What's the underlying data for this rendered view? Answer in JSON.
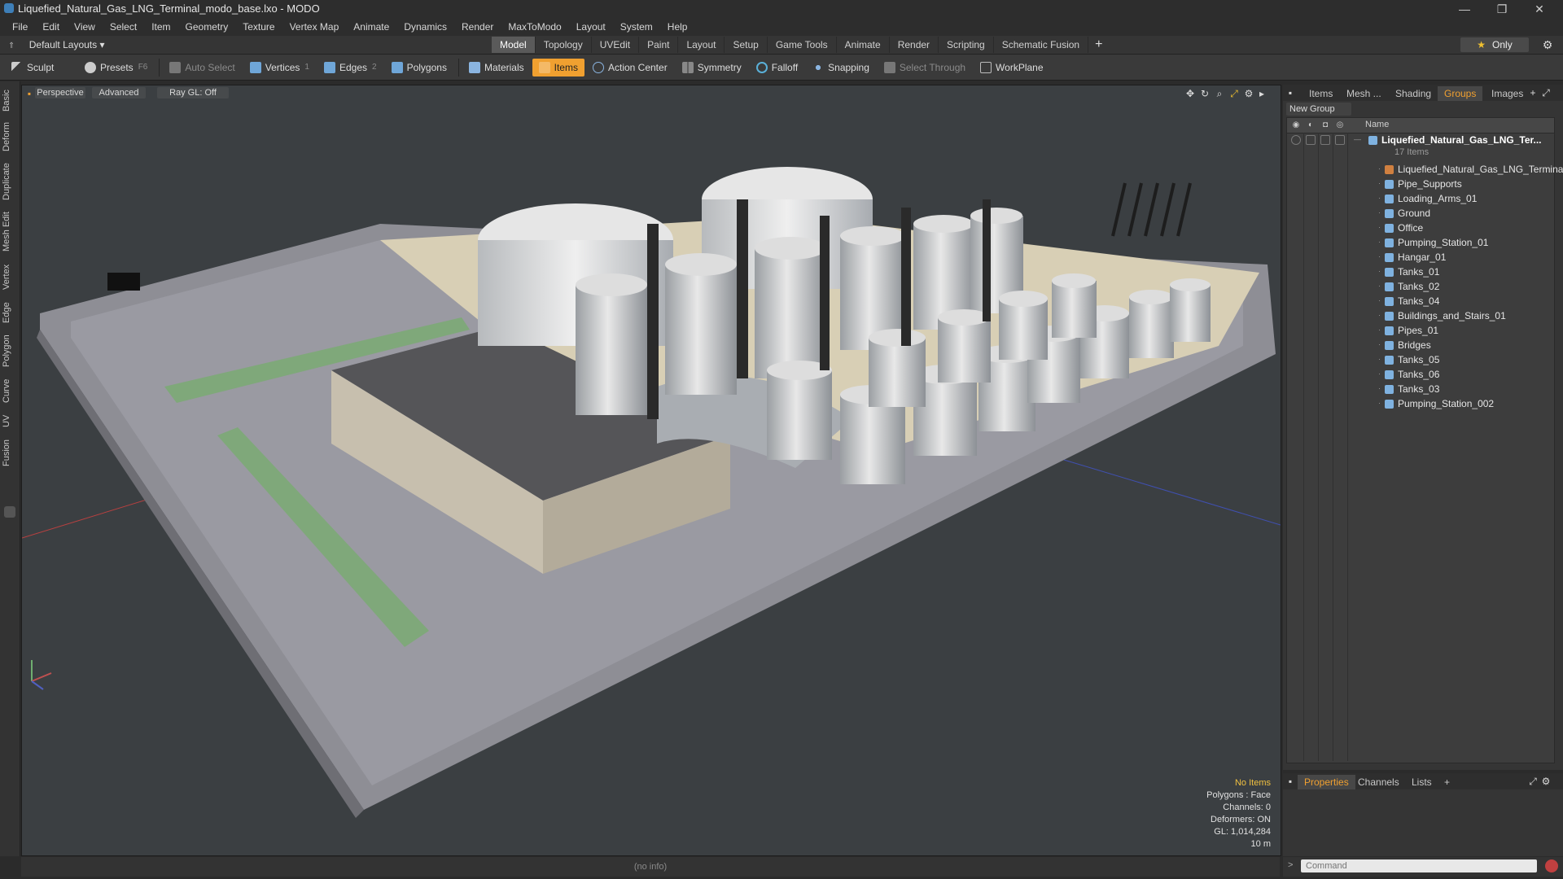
{
  "window": {
    "title": "Liquefied_Natural_Gas_LNG_Terminal_modo_base.lxo - MODO",
    "controls": {
      "minimize": "—",
      "maximize": "❐",
      "close": "✕"
    }
  },
  "menu": [
    "File",
    "Edit",
    "View",
    "Select",
    "Item",
    "Geometry",
    "Texture",
    "Vertex Map",
    "Animate",
    "Dynamics",
    "Render",
    "MaxToModo",
    "Layout",
    "System",
    "Help"
  ],
  "layout_selector": "Default Layouts ▾",
  "tabs": [
    "Model",
    "Topology",
    "UVEdit",
    "Paint",
    "Layout",
    "Setup",
    "Game Tools",
    "Animate",
    "Render",
    "Scripting",
    "Schematic Fusion"
  ],
  "active_tab": "Model",
  "tabs_plus": "+",
  "only_button": {
    "label": "Only",
    "star": "★"
  },
  "toolbar": {
    "sculpt": "Sculpt",
    "presets": "Presets",
    "presets_key": "F6",
    "auto_select": "Auto Select",
    "vertices": "Vertices",
    "vertices_key": "1",
    "edges": "Edges",
    "edges_key": "2",
    "polygons": "Polygons",
    "materials": "Materials",
    "items": "Items",
    "action_center": "Action Center",
    "symmetry": "Symmetry",
    "falloff": "Falloff",
    "snapping": "Snapping",
    "select_through": "Select Through",
    "workplane": "WorkPlane"
  },
  "left_tabs": [
    "Basic",
    "Deform",
    "Duplicate",
    "Mesh Edit",
    "Vertex",
    "Edge",
    "Polygon",
    "Curve",
    "UV",
    "Fusion"
  ],
  "viewport": {
    "view_mode": "Perspective",
    "shading": "Advanced",
    "raygl": "Ray GL: Off",
    "info": {
      "selection": "No Items",
      "polygons": "Polygons : Face",
      "channels": "Channels: 0",
      "deformers": "Deformers: ON",
      "gl": "GL: 1,014,284",
      "scale": "10 m"
    },
    "status": "(no info)"
  },
  "right_panel": {
    "tabs": [
      "Items",
      "Mesh ...",
      "Shading",
      "Groups",
      "Images"
    ],
    "active_tab": "Groups",
    "new_group": "New Group",
    "column_name": "Name",
    "root": {
      "label": "Liquefied_Natural_Gas_LNG_Ter...",
      "count": "17 Items"
    },
    "items": [
      "Liquefied_Natural_Gas_LNG_Terminal",
      "Pipe_Supports",
      "Loading_Arms_01",
      "Ground",
      "Office",
      "Pumping_Station_01",
      "Hangar_01",
      "Tanks_01",
      "Tanks_02",
      "Tanks_04",
      "Buildings_and_Stairs_01",
      "Pipes_01",
      "Bridges",
      "Tanks_05",
      "Tanks_06",
      "Tanks_03",
      "Pumping_Station_002"
    ]
  },
  "properties_panel": {
    "tabs": [
      "Properties",
      "Channels",
      "Lists"
    ],
    "active_tab": "Properties",
    "plus": "+"
  },
  "command": {
    "placeholder": "Command",
    "arrow": ">"
  },
  "colors": {
    "accent": "#f0a030",
    "background": "#2b2b2b",
    "viewport": "#3b3f42"
  }
}
